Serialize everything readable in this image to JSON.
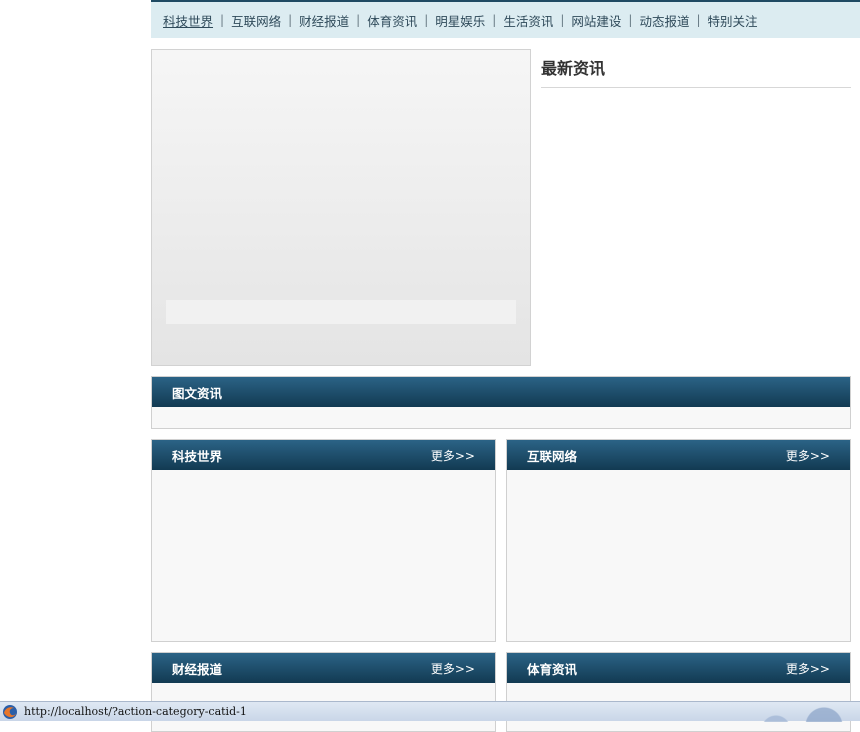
{
  "nav": {
    "items": [
      {
        "label": "科技世界",
        "active": true
      },
      {
        "label": "互联网络"
      },
      {
        "label": "财经报道"
      },
      {
        "label": "体育资讯"
      },
      {
        "label": "明星娱乐"
      },
      {
        "label": "生活资讯"
      },
      {
        "label": "网站建设"
      },
      {
        "label": "动态报道"
      },
      {
        "label": "特别关注"
      }
    ],
    "separator": "|"
  },
  "latest": {
    "title": "最新资讯"
  },
  "sections": {
    "image_news": {
      "title": "图文资讯"
    },
    "tech": {
      "title": "科技世界",
      "more": "更多>>"
    },
    "internet": {
      "title": "互联网络",
      "more": "更多>>"
    },
    "finance": {
      "title": "财经报道",
      "more": "更多>>"
    },
    "sports": {
      "title": "体育资讯",
      "more": "更多>>"
    }
  },
  "status": {
    "url": "http://localhost/?action-category-catid-1"
  },
  "colors": {
    "bar_top": "#2b6386",
    "bar_bottom": "#123a52",
    "nav_bg": "#dcecf1"
  }
}
